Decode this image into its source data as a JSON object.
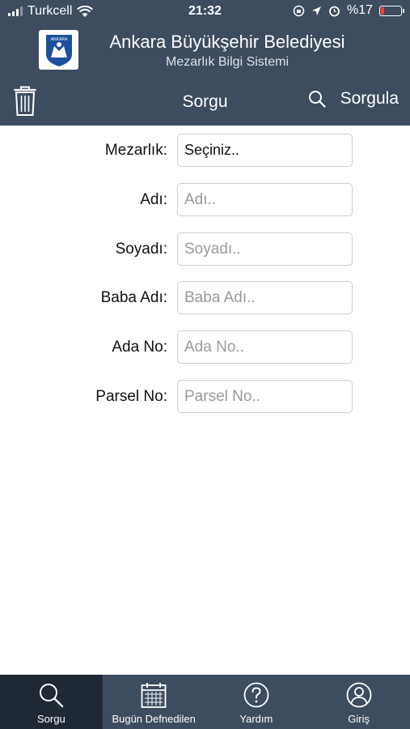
{
  "status_bar": {
    "carrier": "Turkcell",
    "time": "21:32",
    "battery_percent": "%17",
    "battery_level": 0.17
  },
  "header": {
    "title": "Ankara Büyükşehir Belediyesi",
    "subtitle": "Mezarlık Bilgi Sistemi",
    "logo_text": "ANKARA"
  },
  "navbar": {
    "title": "Sorgu",
    "action_label": "Sorgula",
    "left_icon": "trash-icon",
    "action_icon": "search-icon"
  },
  "form": {
    "mezarlik": {
      "label": "Mezarlık:",
      "value": "Seçiniz.."
    },
    "adi": {
      "label": "Adı:",
      "placeholder": "Adı.."
    },
    "soyadi": {
      "label": "Soyadı:",
      "placeholder": "Soyadı.."
    },
    "baba_adi": {
      "label": "Baba Adı:",
      "placeholder": "Baba Adı.."
    },
    "ada_no": {
      "label": "Ada No:",
      "placeholder": "Ada No.."
    },
    "parsel_no": {
      "label": "Parsel No:",
      "placeholder": "Parsel No.."
    }
  },
  "tabbar": {
    "tabs": [
      {
        "label": "Sorgu",
        "icon": "search-icon",
        "active": true
      },
      {
        "label": "Bugün Defnedilen",
        "icon": "calendar-icon",
        "active": false
      },
      {
        "label": "Yardım",
        "icon": "help-icon",
        "active": false
      },
      {
        "label": "Giriş",
        "icon": "user-icon",
        "active": false
      }
    ]
  },
  "colors": {
    "header_bg": "#3d4c5f",
    "active_tab_bg": "#1f2936",
    "battery_low": "#ff3b30"
  }
}
